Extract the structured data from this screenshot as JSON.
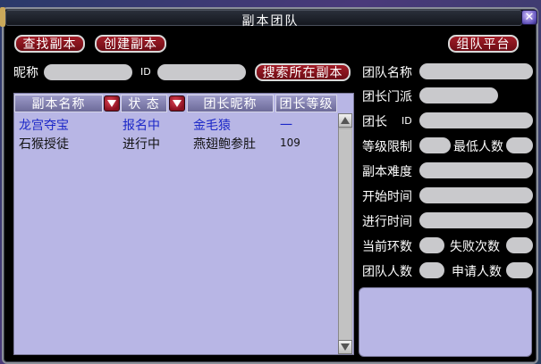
{
  "window": {
    "title": "副本团队",
    "close_glyph": "✕"
  },
  "toolbar": {
    "search_dungeon": "查找副本",
    "create_dungeon": "创建副本",
    "team_platform": "组队平台"
  },
  "search": {
    "nickname_label": "昵称",
    "nickname_value": "",
    "id_label": "ID",
    "id_value": "",
    "search_button": "搜索所在副本"
  },
  "list": {
    "columns": [
      "副本名称",
      "状 态",
      "团长昵称",
      "团长等级"
    ],
    "rows": [
      {
        "dungeon": "龙宫夺宝",
        "status": "报名中",
        "leader": "金毛猿",
        "level": "一",
        "selected": true
      },
      {
        "dungeon": "石猴授徒",
        "status": "进行中",
        "leader": "燕翅鲍参肚",
        "level": "109",
        "selected": false
      }
    ]
  },
  "details": {
    "team_name": "团队名称",
    "leader_sect": "团长门派",
    "leader_id": "团长",
    "leader_id_suffix": "ID",
    "level_limit": "等级限制",
    "min_members": "最低人数",
    "difficulty": "副本难度",
    "start_time": "开始时间",
    "elapsed_time": "进行时间",
    "current_round": "当前环数",
    "fail_count": "失败次数",
    "team_size": "团队人数",
    "applicants": "申请人数"
  },
  "colors": {
    "button_red": "#8a1420",
    "panel_lavender": "#b8b6e5",
    "selected_text": "#1c28c8",
    "field_gray": "#c9c9cc"
  },
  "icons": [
    "close-icon",
    "dropdown-arrow-icon",
    "scroll-up-icon",
    "scroll-down-icon"
  ]
}
